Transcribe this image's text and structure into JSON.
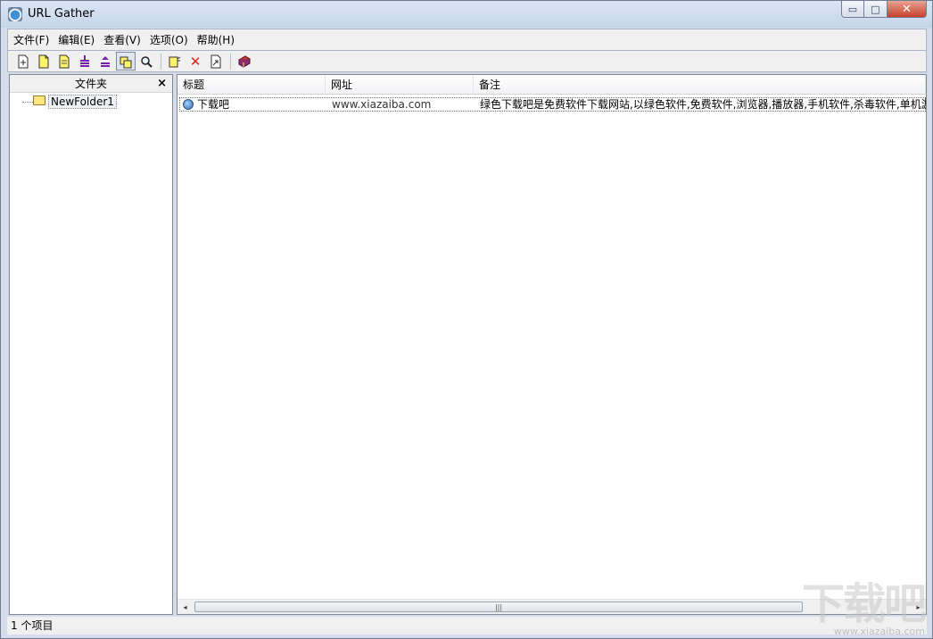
{
  "window": {
    "title": "URL Gather",
    "min_glyph": "▭",
    "max_glyph": "□",
    "close_glyph": "✕"
  },
  "menu": [
    {
      "label": "文件(F)"
    },
    {
      "label": "编辑(E)"
    },
    {
      "label": "查看(V)"
    },
    {
      "label": "选项(O)"
    },
    {
      "label": "帮助(H)"
    }
  ],
  "toolbar": {
    "icons": [
      "new-document-icon",
      "new-folder-doc-icon",
      "new-yellow-doc-icon",
      "move-down-icon",
      "move-up-icon",
      "toggle-folder-view-icon",
      "search-icon",
      "properties-icon",
      "delete-icon",
      "export-icon",
      "help-book-icon"
    ],
    "delete_glyph": "✕"
  },
  "folder_panel": {
    "header": "文件夹",
    "close_glyph": "×",
    "items": [
      {
        "label": "NewFolder1"
      }
    ]
  },
  "list": {
    "columns": [
      "标题",
      "网址",
      "备注"
    ],
    "rows": [
      {
        "title": "下载吧",
        "url": "www.xiazaiba.com",
        "note": "绿色下载吧是免费软件下载网站,以绿色软件,免费软件,浏览器,播放器,手机软件,杀毒软件,单机游戏"
      }
    ],
    "scroll": {
      "left_arrow": "◂",
      "right_arrow": "▸",
      "grip": "|||"
    }
  },
  "status": {
    "text": "1 个项目"
  },
  "watermark": {
    "main": "下载吧",
    "sub": "www.xiazaiba.com"
  },
  "colors": {
    "accent": "#3d8fd6",
    "folder": "#ffe680",
    "close_button": "#c7402a"
  }
}
